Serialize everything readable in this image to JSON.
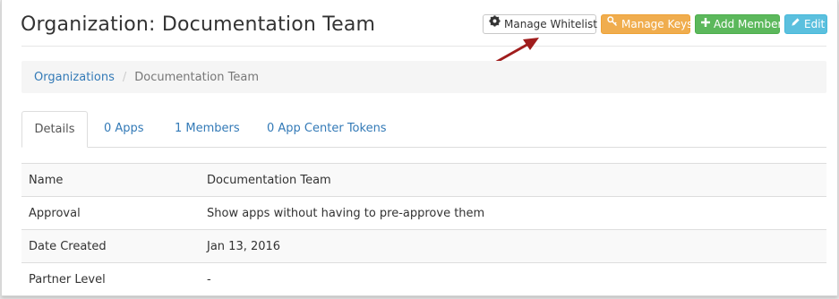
{
  "header": {
    "title": "Organization: Documentation Team",
    "buttons": {
      "whitelist": "Manage Whitelist",
      "keys": "Manage Keys",
      "add_member": "Add Member",
      "edit": "Edit"
    }
  },
  "breadcrumb": {
    "root": "Organizations",
    "separator": "/",
    "current": "Documentation Team"
  },
  "tabs": [
    {
      "label": "Details",
      "active": true
    },
    {
      "label": "0 Apps"
    },
    {
      "label": "1 Members"
    },
    {
      "label": "0 App Center Tokens"
    }
  ],
  "details": [
    {
      "key": "Name",
      "value": "Documentation Team"
    },
    {
      "key": "Approval",
      "value": "Show apps without having to pre-approve them"
    },
    {
      "key": "Date Created",
      "value": "Jan 13, 2016"
    },
    {
      "key": "Partner Level",
      "value": "-"
    }
  ],
  "colors": {
    "link": "#337ab7",
    "warning": "#f0ad4e",
    "success": "#5cb85c",
    "info": "#5bc0de",
    "annotation_arrow": "#a01d1d"
  },
  "icons": {
    "whitelist": "gear-icon",
    "keys": "key-icon",
    "add_member": "plus-icon",
    "edit": "pencil-icon",
    "annotation": "arrow-annotation"
  }
}
